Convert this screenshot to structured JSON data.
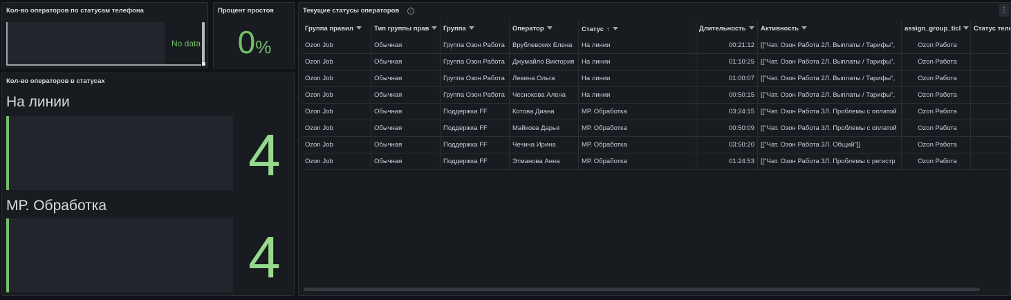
{
  "colors": {
    "accent": "#73bf69",
    "value": "#96d98d",
    "background": "#111217",
    "panel": "#181b1f"
  },
  "panel_phone_status": {
    "title": "Кол-во операторов по статусам телефона",
    "no_data": "No data"
  },
  "panel_idle": {
    "title": "Процент простоя",
    "value": "0",
    "unit": "%"
  },
  "panel_statuses": {
    "title": "Кол-во операторов в статусах",
    "items": [
      {
        "label": "На линии",
        "value": "4"
      },
      {
        "label": "МР. Обработка",
        "value": "4"
      }
    ]
  },
  "panel_table": {
    "title": "Текущие статусы операторов",
    "info_icon": "info-icon",
    "menu_icon": "kebab-menu-icon",
    "columns": [
      "Группа правил",
      "Тип группы прав",
      "Группа",
      "Оператор",
      "Статус",
      "Длительность",
      "Активность",
      "assign_group_ticl",
      "Статус теле"
    ],
    "sort_column": "Статус",
    "sort_direction": "asc",
    "rows": [
      [
        "Ozon Job",
        "Обычная",
        "Группа Озон Работа",
        "Врублевских Елена",
        "На линии",
        "00:21:12",
        "[[\"Чат. Озон Работа 2Л. Выплаты / Тарифы\",",
        "Ozon Работа",
        ""
      ],
      [
        "Ozon Job",
        "Обычная",
        "Группа Озон Работа",
        "Джумайло Виктория",
        "На линии",
        "01:10:25",
        "[[\"Чат. Озон Работа 2Л. Выплаты / Тарифы\",",
        "Ozon Работа",
        ""
      ],
      [
        "Ozon Job",
        "Обычная",
        "Группа Озон Работа",
        "Левина Ольга",
        "На линии",
        "01:00:07",
        "[[\"Чат. Озон Работа 2Л. Выплаты / Тарифы\",",
        "Ozon Работа",
        ""
      ],
      [
        "Ozon Job",
        "Обычная",
        "Группа Озон Работа",
        "Чеснокова Алена",
        "На линии",
        "00:50:15",
        "[[\"Чат. Озон Работа 2Л. Выплаты / Тарифы\",",
        "Ozon Работа",
        ""
      ],
      [
        "Ozon Job",
        "Обычная",
        "Поддержка FF",
        "Котова Диана",
        "МР. Обработка",
        "03:24:15",
        "[[\"Чат. Озон Работа 3Л. Проблемы с оплатой",
        "Ozon Работа",
        ""
      ],
      [
        "Ozon Job",
        "Обычная",
        "Поддержка FF",
        "Майкова Дарья",
        "МР. Обработка",
        "00:50:09",
        "[[\"Чат. Озон Работа 3Л. Проблемы с оплатой",
        "Ozon Работа",
        ""
      ],
      [
        "Ozon Job",
        "Обычная",
        "Поддержка FF",
        "Чечина Ирина",
        "МР. Обработка",
        "03:50:20",
        "[[\"Чат. Озон Работа 3Л. Общий\"]]",
        "Ozon Работа",
        ""
      ],
      [
        "Ozon Job",
        "Обычная",
        "Поддержка FF",
        "Этманова Анна",
        "МР. Обработка",
        "01:24:53",
        "[[\"Чат. Озон Работа 3Л. Проблемы с регистр",
        "Ozon Работа",
        ""
      ]
    ]
  }
}
